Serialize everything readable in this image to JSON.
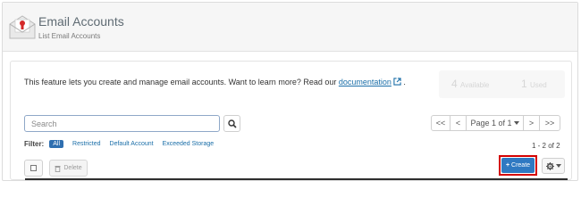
{
  "header": {
    "title": "Email Accounts",
    "subtitle": "List Email Accounts",
    "icon": "envelope-icon"
  },
  "intro": {
    "text": "This feature lets you create and manage email accounts. Want to learn more? Read our ",
    "link_label": "documentation",
    "suffix": "."
  },
  "stats": {
    "available_count": "4",
    "available_label": "Available",
    "used_count": "1",
    "used_label": "Used"
  },
  "search": {
    "placeholder": "Search",
    "value": ""
  },
  "filter": {
    "label": "Filter:",
    "options": [
      "All",
      "Restricted",
      "Default Account",
      "Exceeded Storage"
    ],
    "active": "All"
  },
  "pagination": {
    "first": "<<",
    "prev": "<",
    "page_label": "Page 1 of 1",
    "next": ">",
    "last": ">>",
    "count": "1 - 2 of 2"
  },
  "toolbar": {
    "delete_label": "Delete",
    "create_label": "Create"
  },
  "colors": {
    "accent": "#2f79c2",
    "highlight_outline": "#d40000",
    "link": "#1a6ea8"
  }
}
